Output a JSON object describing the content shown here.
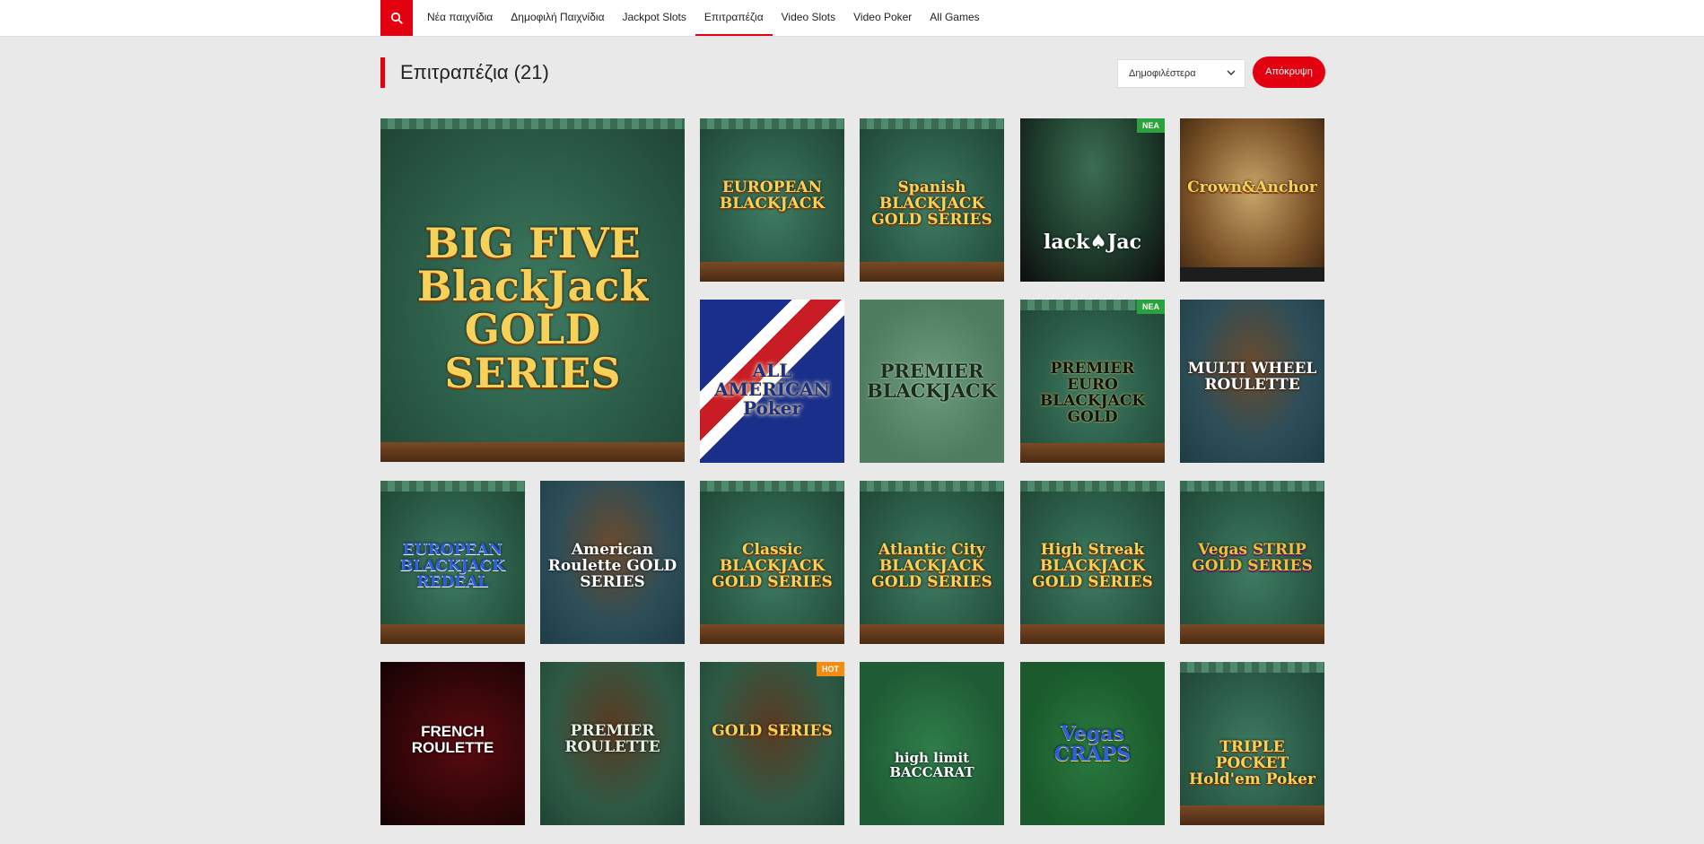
{
  "nav": {
    "items": [
      {
        "label": "Νέα παιχνίδια",
        "active": false
      },
      {
        "label": "Δημοφιλή Παιχνίδια",
        "active": false
      },
      {
        "label": "Jackpot Slots",
        "active": false
      },
      {
        "label": "Επιτραπέζια",
        "active": true
      },
      {
        "label": "Video Slots",
        "active": false
      },
      {
        "label": "Video Poker",
        "active": false
      },
      {
        "label": "All Games",
        "active": false
      }
    ]
  },
  "section": {
    "title": "Επιτραπέζια (21)",
    "sort_value": "Δημοφιλέστερα",
    "hide_label": "Απόκρυψη"
  },
  "colors": {
    "accent": "#e3000f",
    "badge_new": "#2aa33c",
    "badge_hot": "#f28c12"
  },
  "badges": {
    "new": "ΝΕΑ",
    "hot": "HOT"
  },
  "tiles": [
    {
      "name": "BIG FIVE BlackJack GOLD SERIES",
      "badge": ""
    },
    {
      "name": "EUROPEAN BLACKJACK",
      "badge": ""
    },
    {
      "name": "Spanish BLACKJACK GOLD SERIES",
      "badge": ""
    },
    {
      "name": "lack♠Jac",
      "badge": "new"
    },
    {
      "name": "Crown&Anchor",
      "badge": ""
    },
    {
      "name": "ALL AMERICAN Poker",
      "badge": ""
    },
    {
      "name": "PREMIER BLACKJACK",
      "badge": ""
    },
    {
      "name": "PREMIER EURO BLACKJACK GOLD",
      "badge": "new"
    },
    {
      "name": "MULTI WHEEL ROULETTE",
      "badge": ""
    },
    {
      "name": "EUROPEAN BLACKJACK REDEAL",
      "badge": ""
    },
    {
      "name": "American Roulette GOLD SERIES",
      "badge": ""
    },
    {
      "name": "Classic BLACKJACK GOLD SERIES",
      "badge": ""
    },
    {
      "name": "Atlantic City BLACKJACK GOLD SERIES",
      "badge": ""
    },
    {
      "name": "High Streak BLACKJACK GOLD SERIES",
      "badge": ""
    },
    {
      "name": "Vegas STRIP GOLD SERIES",
      "badge": ""
    },
    {
      "name": "FRENCH ROULETTE",
      "badge": ""
    },
    {
      "name": "PREMIER ROULETTE",
      "badge": ""
    },
    {
      "name": "GOLD SERIES",
      "badge": "hot"
    },
    {
      "name": "high limit BACCARAT",
      "badge": ""
    },
    {
      "name": "Vegas CRAPS",
      "badge": ""
    },
    {
      "name": "TRIPLE POCKET Hold'em Poker",
      "badge": ""
    }
  ]
}
